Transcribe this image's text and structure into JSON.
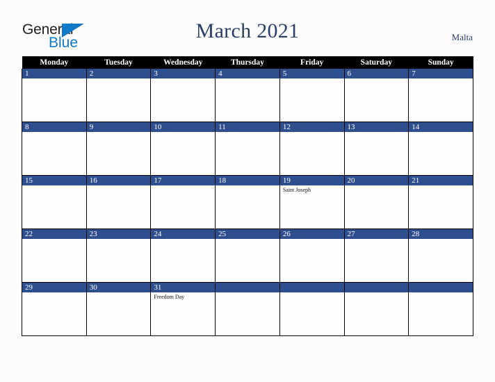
{
  "brand": {
    "name_part1": "General",
    "name_part2": "Blue",
    "triangle_color": "#1278c8",
    "text_color": "#231f20"
  },
  "header": {
    "title": "March 2021",
    "region": "Malta",
    "title_color": "#2b3f66"
  },
  "calendar": {
    "weekday_headers": [
      "Monday",
      "Tuesday",
      "Wednesday",
      "Thursday",
      "Friday",
      "Saturday",
      "Sunday"
    ],
    "header_bg": "#000000",
    "daynum_bg": "#2e4f8e",
    "daynum_color": "#ffffff",
    "cell_bg": "#fdfdfd",
    "border_color": "#000000",
    "weeks": [
      [
        {
          "day": "1",
          "events": []
        },
        {
          "day": "2",
          "events": []
        },
        {
          "day": "3",
          "events": []
        },
        {
          "day": "4",
          "events": []
        },
        {
          "day": "5",
          "events": []
        },
        {
          "day": "6",
          "events": []
        },
        {
          "day": "7",
          "events": []
        }
      ],
      [
        {
          "day": "8",
          "events": []
        },
        {
          "day": "9",
          "events": []
        },
        {
          "day": "10",
          "events": []
        },
        {
          "day": "11",
          "events": []
        },
        {
          "day": "12",
          "events": []
        },
        {
          "day": "13",
          "events": []
        },
        {
          "day": "14",
          "events": []
        }
      ],
      [
        {
          "day": "15",
          "events": []
        },
        {
          "day": "16",
          "events": []
        },
        {
          "day": "17",
          "events": []
        },
        {
          "day": "18",
          "events": []
        },
        {
          "day": "19",
          "events": [
            "Saint Joseph"
          ]
        },
        {
          "day": "20",
          "events": []
        },
        {
          "day": "21",
          "events": []
        }
      ],
      [
        {
          "day": "22",
          "events": []
        },
        {
          "day": "23",
          "events": []
        },
        {
          "day": "24",
          "events": []
        },
        {
          "day": "25",
          "events": []
        },
        {
          "day": "26",
          "events": []
        },
        {
          "day": "27",
          "events": []
        },
        {
          "day": "28",
          "events": []
        }
      ],
      [
        {
          "day": "29",
          "events": []
        },
        {
          "day": "30",
          "events": []
        },
        {
          "day": "31",
          "events": [
            "Freedom Day"
          ]
        },
        {
          "day": "",
          "events": []
        },
        {
          "day": "",
          "events": []
        },
        {
          "day": "",
          "events": []
        },
        {
          "day": "",
          "events": []
        }
      ]
    ]
  }
}
